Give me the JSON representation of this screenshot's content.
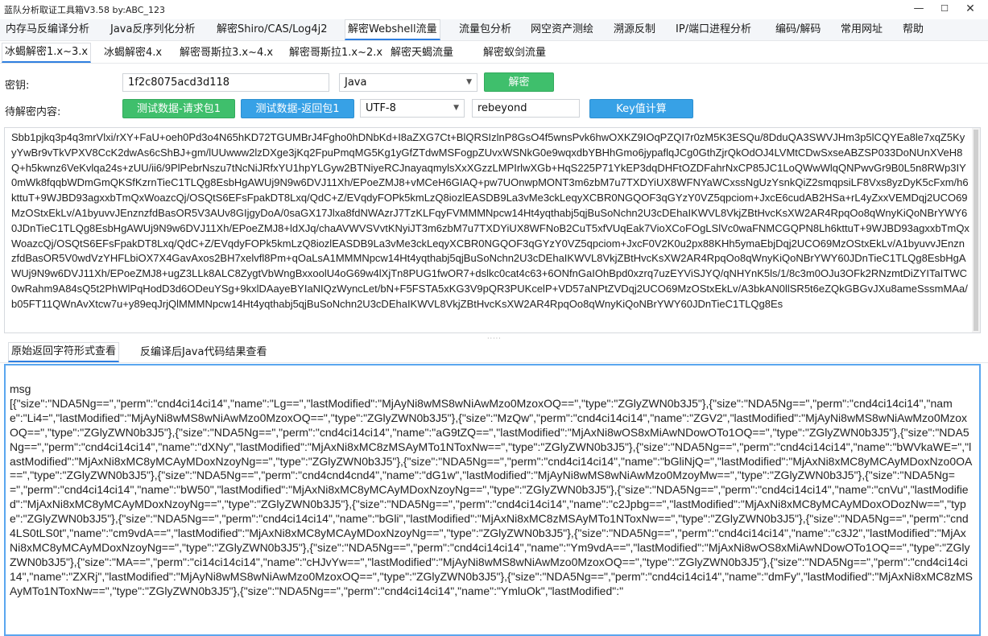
{
  "window": {
    "title": "蓝队分析取证工具箱V3.58 by:ABC_123",
    "minimize": "—",
    "maximize": "☐",
    "close": "✕"
  },
  "menu": [
    {
      "label": "内存马反编译分析"
    },
    {
      "label": "Java反序列化分析"
    },
    {
      "label": "解密Shiro/CAS/Log4j2"
    },
    {
      "label": "解密Webshell流量"
    },
    {
      "label": "流量包分析"
    },
    {
      "label": "网空资产测绘"
    },
    {
      "label": "溯源反制"
    },
    {
      "label": "IP/端口进程分析"
    },
    {
      "label": "编码/解码"
    },
    {
      "label": "常用网址"
    },
    {
      "label": "帮助"
    }
  ],
  "menu_active_index": 3,
  "subtabs": [
    {
      "label": "冰蝎解密1.x~3.x"
    },
    {
      "label": "冰蝎解密4.x"
    },
    {
      "label": "解密哥斯拉3.x~4.x"
    },
    {
      "label": "解密哥斯拉1.x~2.x"
    },
    {
      "label": "解密天蝎流量"
    },
    {
      "label": "解密蚁剑流量"
    }
  ],
  "form": {
    "key_label": "密钥:",
    "key_value": "1f2c8075acd3d118",
    "lang_select": "Java",
    "decrypt_button": "解密",
    "content_label": "待解密内容:",
    "test_request_button": "测试数据-请求包1",
    "test_response_button": "测试数据-返回包1",
    "encoding_select": "UTF-8",
    "password_value": "rebeyond",
    "key_calc_button": "Key值计算"
  },
  "ciphertext": "Sbb1pjkq3p4q3mrVlxi/rXY+FaU+oeh0Pd3o4N65hKD72TGUMBrJ4Fgho0hDNbKd+I8aZXG7Ct+BlQRSIzlnP8GsO4f5wnsPvk6hwOXKZ9IOqPZQI7r0zM5K3ESQu/8DduQA3SWVJHm3p5lCQYEa8le7xqZ5KyyYwBr9vTkVPXV8CcK2dwAs6cShBJ+gm/lUUwww2lzDXge3jKq2FpuPmqMG5Kg1yGfZTdwMSFogpZUvxWSNkG0e9wqxdbYBHhGmo6jypaflqJCg0GthZjrQkOdOJ4LVMtCDwSxseABZSP033DoNUnXVeH8Q+h5kwnz6VeKvlqa24s+zUU/ii6/9PlPebrNszu7tNcNiJRfxYU1hpYLGyw2BTNiyeRCJnayaqmylsXxXGzzLMPIrlwXGb+HqS225P71YkEP3dqDHFtOZDFahrNxCP85JC1LoQWwWlqQNPwvGr9B0L5n8RWp3IY0mWk8fqqbWDmGmQKSfKzrnTieC1TLQg8EsbHgAWUj9N9w6DVJ11Xh/EPoeZMJ8+vMCeH6GIAQ+pw7UOnwpMONT3m6zbM7u7TXDYiUX8WFNYaWCxssNgUzYsnkQiZ2smqpsiLF8Vxs8yzDyK5cFxm/h6kttuT+9WJBD93agxxbTmQxWoazcQj/OSQtS6EFsFpakDT8Lxq/QdC+Z/EVqdyFOPk5kmLzQ8iozlEASDB9La3vMe3ckLeqyXCBR0NGQOF3qGYzY0VZ5qpciom+JxcE6cudAB2HSa+rL4yZxxVEMDqj2UCO69MzOStxEkLv/A1byuvvJEnznzfdBasOR5V3AUv8GIjgyDoA/0saGX17Jlxa8fdNWAzrJ7TzKLFqyFVMMMNpcw14Ht4yqthabj5qjBuSoNchn2U3cDEhaIKWVL8VkjZBtHvcKsXW2AR4RpqOo8qWnyKiQoNBrYWY60JDnTieC1TLQg8EsbHgAWUj9N9w6DVJ11Xh/EPoeZMJ8+ldXJq/chaAVWVSVvtKNyiJT3m6zbM7u7TXDYiUX8WFNoB2CuT5xfVUqEak7VioXCoFOgLSlVc0waFNMCGQPN8Lh6kttuT+9WJBD93agxxbTmQxWoazcQj/OSQtS6EFsFpakDT8Lxq/QdC+Z/EVqdyFOPk5kmLzQ8iozlEASDB9La3vMe3ckLeqyXCBR0NGQOF3qGYzY0VZ5qpciom+JxcF0V2K0u2px88KHh5ymaEbjDqj2UCO69MzOStxEkLv/A1byuvvJEnznzfdBasOR5V0wdVzYHFLbiOX7X4GavAxos2BH7xelvfl8Pm+qOaLsA1MMMNpcw14Ht4yqthabj5qjBuSoNchn2U3cDEhaIKWVL8VkjZBtHvcKsXW2AR4RpqOo8qWnyKiQoNBrYWY60JDnTieC1TLQg8EsbHgAWUj9N9w6DVJ11Xh/EPoeZMJ8+ugZ3LLk8ALC8ZygtVbWngBxxoolU4oG69w4lXjTn8PUG1fwOR7+dslkc0cat4c63+6ONfnGaIOhBpd0xzrq7uzEYViSJYQ/qNHYnK5ls/1/8c3m0OJu3OFk2RNzmtDiZYITaITWC0wRahm9A84sQ5t2PhWlPqHodD3d6ODeuYSg+9kxlDAayeBYIaNIQzWyncLet/bN+F5FSTA5xKG3V9pQR3PUKcelP+VD57aNPtZVDqj2UCO69MzOStxEkLv/A3bkAN0llSR5t6eZQkGBGvJXu8ameSssmMAa/b05FT11QWnAvXtcw7u+y89eqJrjQlMMMNpcw14Ht4yqthabj5qjBuSoNchn2U3cDEhaIKWVL8VkjZBtHvcKsXW2AR4RpqOo8qWnyKiQoNBrYWY60JDnTieC1TLQg8Es",
  "result_tabs": [
    {
      "label": "原始返回字符形式查看"
    },
    {
      "label": "反编译后Java代码结果查看"
    }
  ],
  "result_text": "msg\n[{\"size\":\"NDA5Ng==\",\"perm\":\"cnd4ci14ci14\",\"name\":\"Lg==\",\"lastModified\":\"MjAyNi8wMS8wNiAwMzo0MzoxOQ==\",\"type\":\"ZGlyZWN0b3J5\"},{\"size\":\"NDA5Ng==\",\"perm\":\"cnd4ci14ci14\",\"name\":\"Li4=\",\"lastModified\":\"MjAyNi8wMS8wNiAwMzo0MzoxOQ==\",\"type\":\"ZGlyZWN0b3J5\"},{\"size\":\"MzQw\",\"perm\":\"cnd4ci14ci14\",\"name\":\"ZGV2\",\"lastModified\":\"MjAyNi8wMS8wNiAwMzo0MzoxOQ==\",\"type\":\"ZGlyZWN0b3J5\"},{\"size\":\"NDA5Ng==\",\"perm\":\"cnd4ci14ci14\",\"name\":\"aG9tZQ==\",\"lastModified\":\"MjAxNi8wOS8xMiAwNDowOTo1OQ==\",\"type\":\"ZGlyZWN0b3J5\"},{\"size\":\"NDA5Ng==\",\"perm\":\"cnd4ci14ci14\",\"name\":\"dXNy\",\"lastModified\":\"MjAxNi8xMC8zMSAyMTo1NToxNw==\",\"type\":\"ZGlyZWN0b3J5\"},{\"size\":\"NDA5Ng==\",\"perm\":\"cnd4ci14ci14\",\"name\":\"bWVkaWE=\",\"lastModified\":\"MjAxNi8xMC8yMCAyMDoxNzoyNg==\",\"type\":\"ZGlyZWN0b3J5\"},{\"size\":\"NDA5Ng==\",\"perm\":\"cnd4ci14ci14\",\"name\":\"bGliNjQ=\",\"lastModified\":\"MjAxNi8xMC8yMCAyMDoxNzo0OA==\",\"type\":\"ZGlyZWN0b3J5\"},{\"size\":\"NDA5Ng==\",\"perm\":\"cnd4cnd4cnd4\",\"name\":\"dG1w\",\"lastModified\":\"MjAyNi8wMS8wNiAwMzo0MzoyMw==\",\"type\":\"ZGlyZWN0b3J5\"},{\"size\":\"NDA5Ng==\",\"perm\":\"cnd4ci14ci14\",\"name\":\"bW50\",\"lastModified\":\"MjAxNi8xMC8yMCAyMDoxNzoyNg==\",\"type\":\"ZGlyZWN0b3J5\"},{\"size\":\"NDA5Ng==\",\"perm\":\"cnd4ci14ci14\",\"name\":\"cnVu\",\"lastModified\":\"MjAxNi8xMC8yMCAyMDoxNzoyNg==\",\"type\":\"ZGlyZWN0b3J5\"},{\"size\":\"NDA5Ng==\",\"perm\":\"cnd4ci14ci14\",\"name\":\"c2Jpbg==\",\"lastModified\":\"MjAxNi8xMC8yMCAyMDoxODozNw==\",\"type\":\"ZGlyZWN0b3J5\"},{\"size\":\"NDA5Ng==\",\"perm\":\"cnd4ci14ci14\",\"name\":\"bGli\",\"lastModified\":\"MjAxNi8xMC8zMSAyMTo1NToxNw==\",\"type\":\"ZGlyZWN0b3J5\"},{\"size\":\"NDA5Ng==\",\"perm\":\"cnd4LS0tLS0t\",\"name\":\"cm9vdA==\",\"lastModified\":\"MjAxNi8xMC8yMCAyMDoxNzoyNg==\",\"type\":\"ZGlyZWN0b3J5\"},{\"size\":\"NDA5Ng==\",\"perm\":\"cnd4ci14ci14\",\"name\":\"c3J2\",\"lastModified\":\"MjAxNi8xMC8yMCAyMDoxNzoyNg==\",\"type\":\"ZGlyZWN0b3J5\"},{\"size\":\"NDA5Ng==\",\"perm\":\"cnd4ci14ci14\",\"name\":\"Ym9vdA==\",\"lastModified\":\"MjAxNi8wOS8xMiAwNDowOTo1OQ==\",\"type\":\"ZGlyZWN0b3J5\"},{\"size\":\"MA==\",\"perm\":\"ci14ci14ci14\",\"name\":\"cHJvYw==\",\"lastModified\":\"MjAyNi8wMS8wNiAwMzo0MzoxOQ==\",\"type\":\"ZGlyZWN0b3J5\"},{\"size\":\"NDA5Ng==\",\"perm\":\"cnd4ci14ci14\",\"name\":\"ZXRj\",\"lastModified\":\"MjAyNi8wMS8wNiAwMzo0MzoxOQ==\",\"type\":\"ZGlyZWN0b3J5\"},{\"size\":\"NDA5Ng==\",\"perm\":\"cnd4ci14ci14\",\"name\":\"dmFy\",\"lastModified\":\"MjAxNi8xMC8zMSAyMTo1NToxNw==\",\"type\":\"ZGlyZWN0b3J5\"},{\"size\":\"NDA5Ng==\",\"perm\":\"cnd4ci14ci14\",\"name\":\"YmluOk\",\"lastModified\":\""
}
